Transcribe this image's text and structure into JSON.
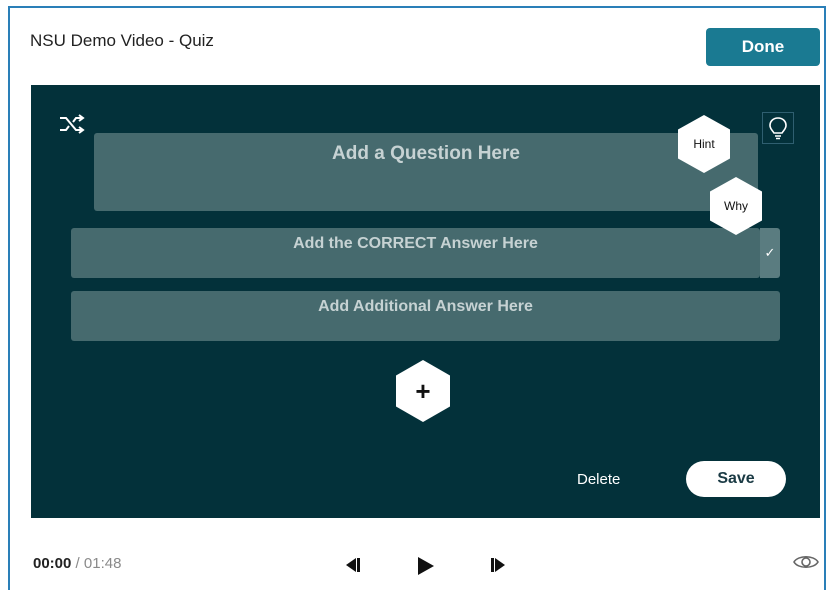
{
  "header": {
    "title": "NSU Demo Video - Quiz",
    "done_label": "Done"
  },
  "editor": {
    "question_placeholder": "Add a Question Here",
    "correct_answer_placeholder": "Add the CORRECT Answer Here",
    "additional_answer_placeholder": "Add Additional Answer Here",
    "hint_label": "Hint",
    "why_label": "Why",
    "add_label": "+",
    "correct_mark": "✓",
    "delete_label": "Delete",
    "save_label": "Save"
  },
  "player": {
    "current_time": "00:00",
    "separator": " / ",
    "duration": "01:48"
  },
  "icons": {
    "shuffle": "shuffle-icon",
    "lightbulb": "lightbulb-icon",
    "prev": "step-back-icon",
    "play": "play-icon",
    "next": "step-forward-icon",
    "eye": "eye-icon"
  },
  "colors": {
    "accent": "#1a7a92",
    "editor_bg": "#03313a",
    "field_bg": "#466a6e"
  }
}
